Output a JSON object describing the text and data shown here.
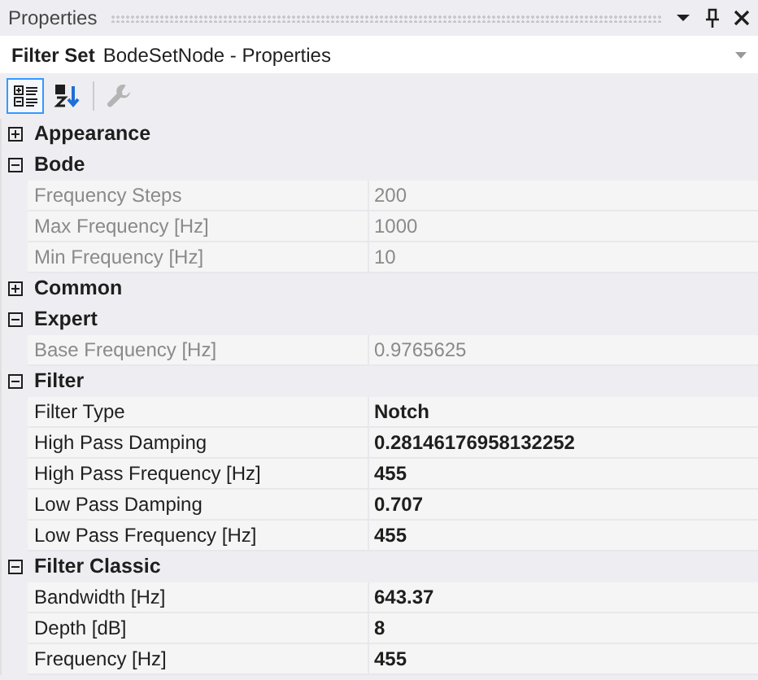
{
  "panel": {
    "title": "Properties"
  },
  "selector": {
    "type": "Filter Set",
    "name": "BodeSetNode - Properties"
  },
  "toolbar": [
    {
      "kind": "categorized",
      "selected": true,
      "disabled": false
    },
    {
      "kind": "alphabetical",
      "selected": false,
      "disabled": false
    },
    {
      "kind": "property-pages",
      "selected": false,
      "disabled": true
    }
  ],
  "categories": [
    {
      "name": "Appearance",
      "expanded": false
    },
    {
      "name": "Bode",
      "expanded": true,
      "properties": [
        {
          "name": "Frequency Steps",
          "value": "200",
          "readonly": true,
          "modified": false
        },
        {
          "name": "Max Frequency [Hz]",
          "value": "1000",
          "readonly": true,
          "modified": false
        },
        {
          "name": "Min Frequency [Hz]",
          "value": "10",
          "readonly": true,
          "modified": false
        }
      ]
    },
    {
      "name": "Common",
      "expanded": false
    },
    {
      "name": "Expert",
      "expanded": true,
      "properties": [
        {
          "name": "Base Frequency [Hz]",
          "value": "0.9765625",
          "readonly": true,
          "modified": false
        }
      ]
    },
    {
      "name": "Filter",
      "expanded": true,
      "properties": [
        {
          "name": "Filter Type",
          "value": "Notch",
          "readonly": false,
          "modified": true
        },
        {
          "name": "High Pass Damping",
          "value": "0.28146176958132252",
          "readonly": false,
          "modified": true
        },
        {
          "name": "High Pass Frequency [Hz]",
          "value": "455",
          "readonly": false,
          "modified": true
        },
        {
          "name": "Low Pass Damping",
          "value": "0.707",
          "readonly": false,
          "modified": true
        },
        {
          "name": "Low Pass Frequency [Hz]",
          "value": "455",
          "readonly": false,
          "modified": true
        }
      ]
    },
    {
      "name": "Filter Classic",
      "expanded": true,
      "properties": [
        {
          "name": "Bandwidth [Hz]",
          "value": "643.37",
          "readonly": false,
          "modified": true
        },
        {
          "name": "Depth [dB]",
          "value": "8",
          "readonly": false,
          "modified": true
        },
        {
          "name": "Frequency [Hz]",
          "value": "455",
          "readonly": false,
          "modified": true
        }
      ]
    }
  ]
}
